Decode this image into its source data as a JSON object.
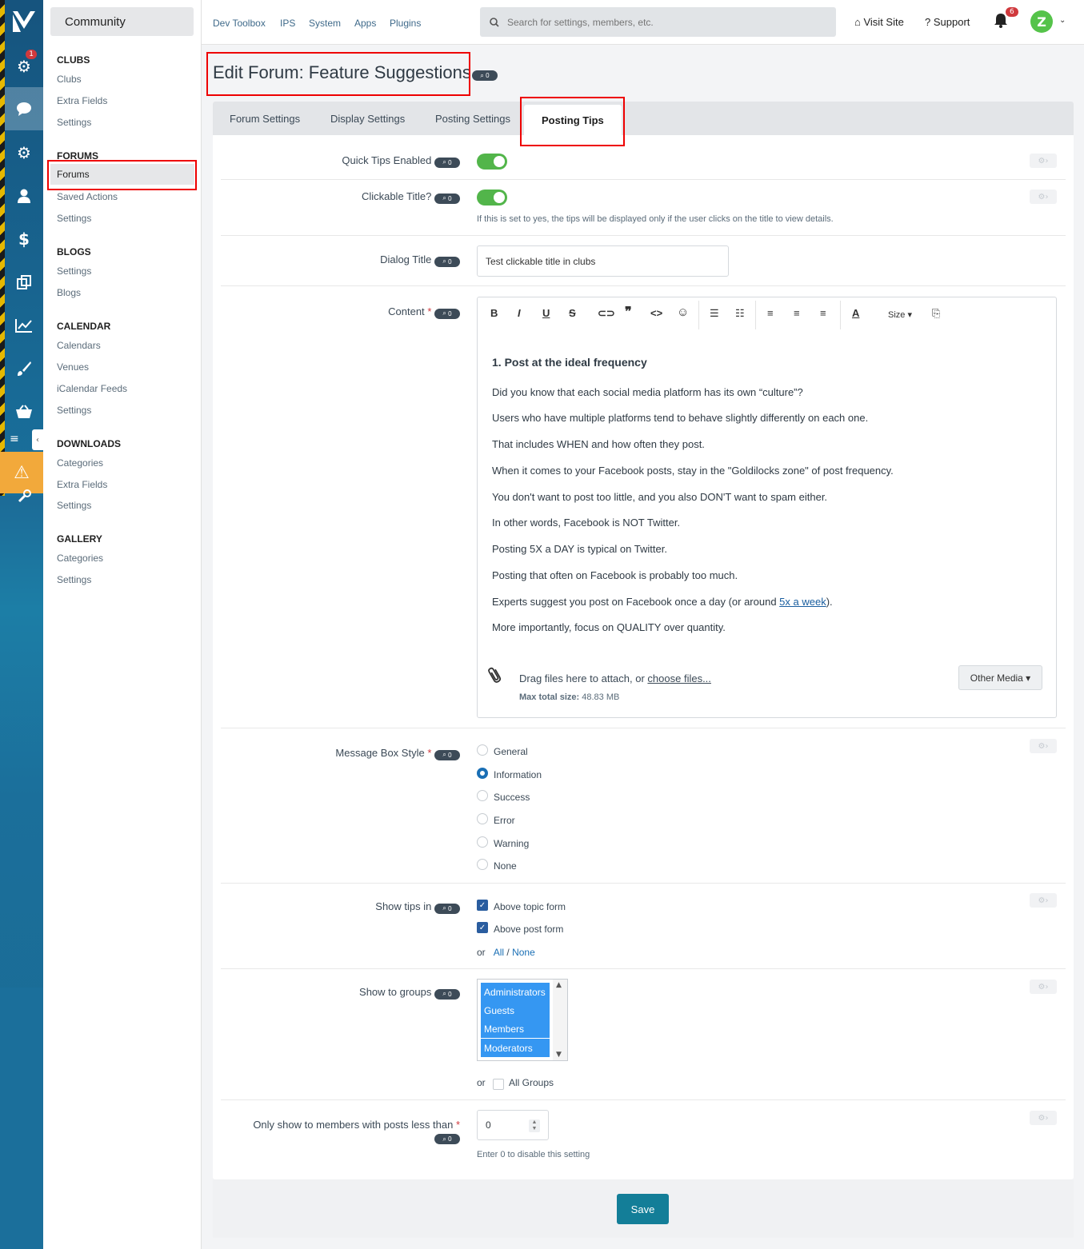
{
  "rail": {
    "notifications_badge": "1"
  },
  "sidebar": {
    "section_title": "Community",
    "groups": [
      {
        "heading": "CLUBS",
        "items": [
          "Clubs",
          "Extra Fields",
          "Settings"
        ]
      },
      {
        "heading": "FORUMS",
        "items": [
          "Forums",
          "Saved Actions",
          "Settings"
        ]
      },
      {
        "heading": "BLOGS",
        "items": [
          "Settings",
          "Blogs"
        ]
      },
      {
        "heading": "CALENDAR",
        "items": [
          "Calendars",
          "Venues",
          "iCalendar Feeds",
          "Settings"
        ]
      },
      {
        "heading": "DOWNLOADS",
        "items": [
          "Categories",
          "Extra Fields",
          "Settings"
        ]
      },
      {
        "heading": "GALLERY",
        "items": [
          "Categories",
          "Settings"
        ]
      }
    ]
  },
  "topbar": {
    "nav": [
      "Dev Toolbox",
      "IPS",
      "System",
      "Apps",
      "Plugins"
    ],
    "search_placeholder": "Search for settings, members, etc.",
    "visit_site": "Visit Site",
    "support": "Support",
    "notifications_count": "6",
    "avatar_letter": "Z"
  },
  "page": {
    "title": "Edit Forum: Feature Suggestions",
    "badge": "0"
  },
  "tabs": [
    "Forum Settings",
    "Display Settings",
    "Posting Settings",
    "Posting Tips"
  ],
  "form": {
    "badge": "0",
    "quick_tips_label": "Quick Tips Enabled",
    "clickable_title_label": "Clickable Title?",
    "clickable_title_help": "If this is set to yes, the tips will be displayed only if the user clicks on the title to view details.",
    "dialog_title_label": "Dialog Title",
    "dialog_title_value": "Test clickable title in clubs",
    "content_label": "Content",
    "required_mark": "*",
    "toolbar_size": "Size",
    "content_heading": "1. Post at the ideal frequency",
    "content_paragraphs": [
      "Did you know that each social media platform has its own “culture”?",
      "Users who have multiple platforms tend to behave slightly differently on each one.",
      "That includes WHEN and how often they post.",
      "When it comes to your Facebook posts, stay in the \"Goldilocks zone\" of post frequency.",
      "You don't want to post too little, and you also DON'T want to spam either.",
      "In other words, Facebook is NOT Twitter.",
      "Posting 5X a DAY is typical on Twitter.",
      "Posting that often on Facebook is probably too much."
    ],
    "content_p9_before": "Experts suggest you post on Facebook once a day (or around ",
    "content_p9_link": "5x a week",
    "content_p9_after": ").",
    "content_p10": "More importantly, focus on QUALITY over quantity.",
    "drag_text": "Drag files here to attach, or ",
    "choose_files": "choose files...",
    "max_size_label": "Max total size:",
    "max_size_value": "48.83 MB",
    "other_media": "Other Media",
    "message_box_style_label": "Message Box Style",
    "message_box_options": [
      "General",
      "Information",
      "Success",
      "Error",
      "Warning",
      "None"
    ],
    "message_box_selected": "Information",
    "show_tips_label": "Show tips in",
    "show_tips_options": [
      "Above topic form",
      "Above post form"
    ],
    "or": "or",
    "all": "All",
    "slash": "/",
    "none": "None",
    "show_groups_label": "Show to groups",
    "groups": [
      "Administrators",
      "Guests",
      "Members",
      "Moderators"
    ],
    "all_groups": "All Groups",
    "posts_less_label": "Only show to members with posts less than",
    "posts_less_value": "0",
    "posts_less_help": "Enter 0 to disable this setting"
  },
  "footer": {
    "save": "Save"
  }
}
